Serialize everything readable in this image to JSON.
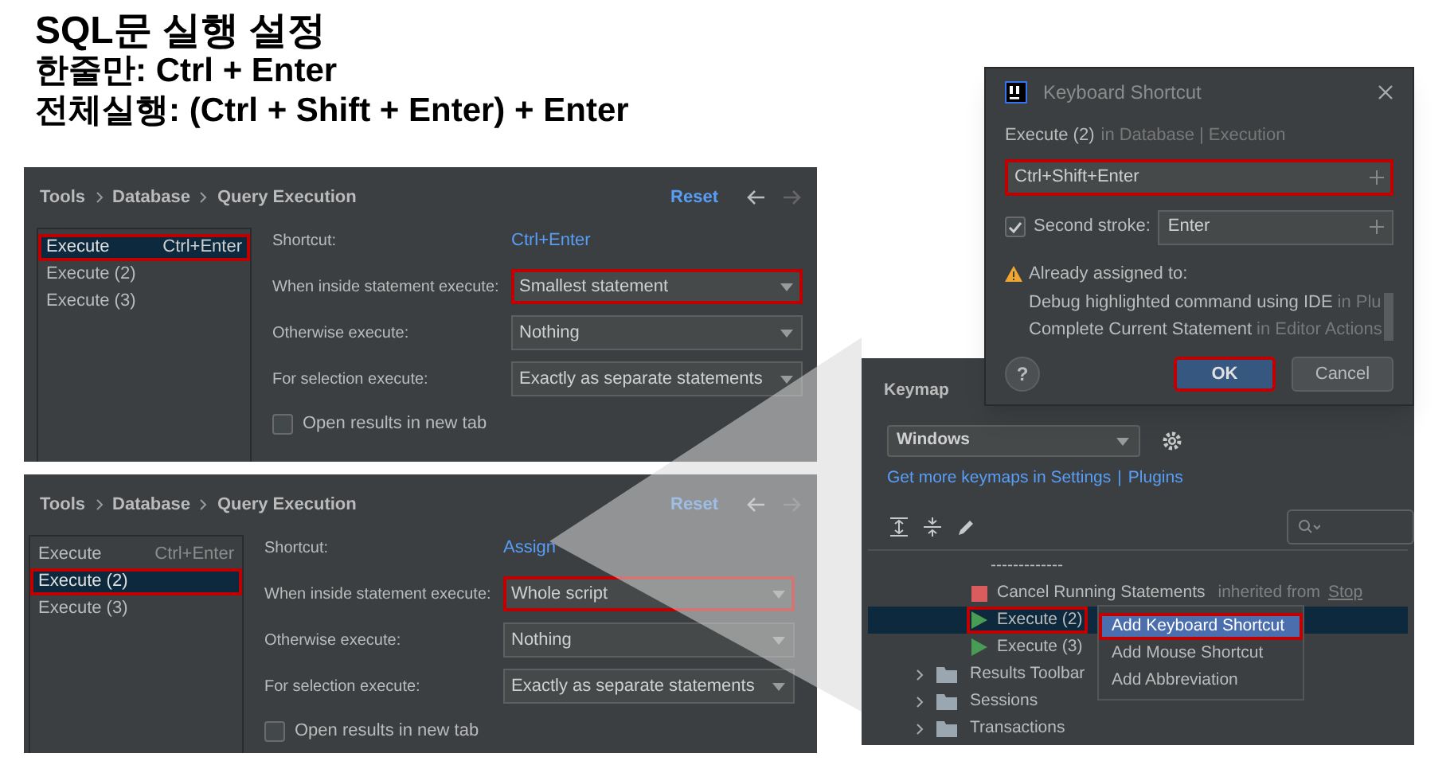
{
  "headline": {
    "title": "SQL문 실행 설정",
    "lines": [
      "한줄만: Ctrl + Enter",
      "전체실행: (Ctrl + Shift + Enter) + Enter"
    ]
  },
  "settings_panels": [
    {
      "breadcrumb": [
        "Tools",
        "Database",
        "Query Execution"
      ],
      "reset": "Reset",
      "actions": [
        {
          "label": "Execute",
          "shortcut": "Ctrl+Enter",
          "selected": true,
          "highlighted": true
        },
        {
          "label": "Execute (2)",
          "selected": false,
          "highlighted": false
        },
        {
          "label": "Execute (3)",
          "selected": false,
          "highlighted": false
        }
      ],
      "shortcut_label": "Shortcut:",
      "shortcut_value": "Ctrl+Enter",
      "fields": [
        {
          "label": "When inside statement execute:",
          "value": "Smallest statement",
          "highlighted": true
        },
        {
          "label": "Otherwise execute:",
          "value": "Nothing",
          "highlighted": false
        },
        {
          "label": "For selection execute:",
          "value": "Exactly as separate statements",
          "highlighted": false
        }
      ],
      "checkbox": {
        "label": "Open results in new tab",
        "checked": false
      }
    },
    {
      "breadcrumb": [
        "Tools",
        "Database",
        "Query Execution"
      ],
      "reset": "Reset",
      "actions": [
        {
          "label": "Execute",
          "shortcut": "Ctrl+Enter",
          "selected": false,
          "highlighted": false
        },
        {
          "label": "Execute (2)",
          "selected": true,
          "highlighted": true
        },
        {
          "label": "Execute (3)",
          "selected": false,
          "highlighted": false
        }
      ],
      "shortcut_label": "Shortcut:",
      "shortcut_value": "Assign",
      "fields": [
        {
          "label": "When inside statement execute:",
          "value": "Whole script",
          "highlighted": true
        },
        {
          "label": "Otherwise execute:",
          "value": "Nothing",
          "highlighted": false
        },
        {
          "label": "For selection execute:",
          "value": "Exactly as separate statements",
          "highlighted": false
        }
      ],
      "checkbox": {
        "label": "Open results in new tab",
        "checked": false
      }
    }
  ],
  "keymap": {
    "title": "Keymap",
    "scheme": "Windows",
    "links": [
      "Get more keymaps in Settings",
      "|",
      "Plugins"
    ],
    "tree": [
      {
        "kind": "group",
        "children": [
          {
            "kind": "separator",
            "label": "-------------",
            "selected": false,
            "highlighted": false
          },
          {
            "kind": "stop",
            "label": "Cancel Running Statements",
            "note": "inherited from",
            "link": "Stop",
            "selected": false,
            "highlighted": false
          },
          {
            "kind": "run",
            "label": "Execute (2)",
            "selected": true,
            "highlighted": true
          },
          {
            "kind": "run",
            "label": "Execute (3)",
            "selected": false,
            "highlighted": false
          }
        ]
      },
      {
        "kind": "folder",
        "label": "Results Toolbar",
        "expanded": false
      },
      {
        "kind": "folder",
        "label": "Sessions",
        "expanded": false
      },
      {
        "kind": "folder",
        "label": "Transactions",
        "expanded": false
      }
    ],
    "context_menu": [
      {
        "label": "Add Keyboard Shortcut",
        "selected": true,
        "highlighted": true
      },
      {
        "label": "Add Mouse Shortcut",
        "selected": false,
        "highlighted": false
      },
      {
        "label": "Add Abbreviation",
        "selected": false,
        "highlighted": false
      }
    ]
  },
  "dialog": {
    "title": "Keyboard Shortcut",
    "action": "Execute (2)",
    "context": "in Database | Execution",
    "first_stroke": {
      "value": "Ctrl+Shift+Enter",
      "highlighted": true
    },
    "second_stroke": {
      "label": "Second stroke:",
      "checked": true,
      "value": "Enter"
    },
    "warning": "Already assigned to:",
    "conflicts": [
      {
        "action": "Debug highlighted command using IDE",
        "context": "in Plu"
      },
      {
        "action": "Complete Current Statement",
        "context": "in Editor Actions"
      }
    ],
    "buttons": [
      {
        "kind": "help",
        "label": "?"
      },
      {
        "kind": "primary",
        "label": "OK",
        "highlighted": true
      },
      {
        "kind": "secondary",
        "label": "Cancel",
        "highlighted": false
      }
    ]
  }
}
